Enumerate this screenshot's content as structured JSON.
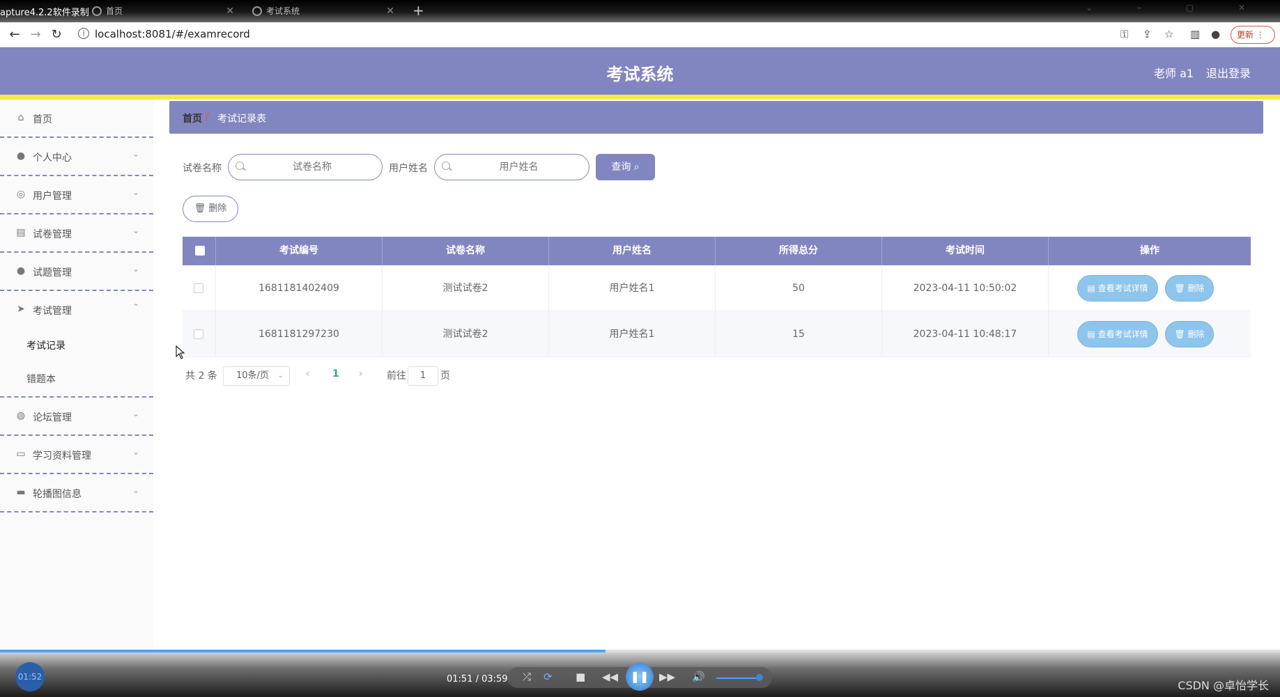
{
  "recorder": {
    "title": "apture4.2.2软件录制"
  },
  "browser": {
    "tabs": [
      {
        "label": "首页"
      },
      {
        "label": "考试系统"
      }
    ],
    "url": "localhost:8081/#/examrecord",
    "update_label": "更新"
  },
  "header": {
    "title": "考试系统",
    "user": "老师 a1",
    "logout": "退出登录"
  },
  "sidebar": {
    "items": [
      {
        "label": "首页",
        "icon": "home-icon"
      },
      {
        "label": "个人中心",
        "icon": "user-icon"
      },
      {
        "label": "用户管理",
        "icon": "dashboard-icon"
      },
      {
        "label": "试卷管理",
        "icon": "paper-icon"
      },
      {
        "label": "试题管理",
        "icon": "bulb-icon"
      },
      {
        "label": "考试管理",
        "icon": "send-icon"
      },
      {
        "label": "论坛管理",
        "icon": "globe-icon"
      },
      {
        "label": "学习资料管理",
        "icon": "chat-icon"
      },
      {
        "label": "轮播图信息",
        "icon": "briefcase-icon"
      }
    ],
    "exam_sub": [
      {
        "label": "考试记录"
      },
      {
        "label": "错题本"
      }
    ]
  },
  "breadcrumb": {
    "home": "首页",
    "separator": "/",
    "current": "考试记录表"
  },
  "filters": {
    "paper_label": "试卷名称",
    "paper_placeholder": "试卷名称",
    "user_label": "用户姓名",
    "user_placeholder": "用户姓名",
    "query_label": "查询"
  },
  "toolbar": {
    "delete_label": "删除"
  },
  "table": {
    "columns": [
      "考试编号",
      "试卷名称",
      "用户姓名",
      "所得总分",
      "考试时间",
      "操作"
    ],
    "rows": [
      {
        "id": "1681181402409",
        "paper": "测试试卷2",
        "user": "用户姓名1",
        "score": "50",
        "time": "2023-04-11 10:50:02"
      },
      {
        "id": "1681181297230",
        "paper": "测试试卷2",
        "user": "用户姓名1",
        "score": "15",
        "time": "2023-04-11 10:48:17"
      }
    ],
    "detail_label": "查看考试详情",
    "delete_label": "删除"
  },
  "pagination": {
    "total": "共 2 条",
    "page_size": "10条/页",
    "current_page": "1",
    "goto_prefix": "前往",
    "goto_value": "1",
    "goto_suffix": "页"
  },
  "player": {
    "clock": "01:52",
    "timecode": "01:51 / 03:59",
    "progress": 0.473,
    "watermark": "CSDN @卓怡学长"
  }
}
